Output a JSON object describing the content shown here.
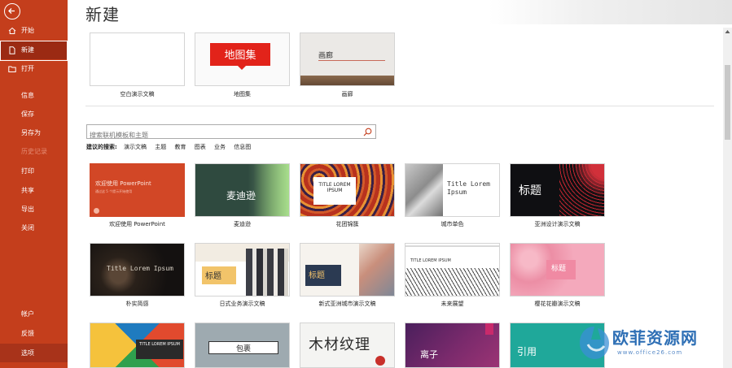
{
  "sidebar": {
    "items": [
      {
        "label": "开始",
        "icon": "home-icon"
      },
      {
        "label": "新建",
        "icon": "new-document-icon"
      },
      {
        "label": "打开",
        "icon": "folder-open-icon"
      },
      {
        "label": "信息"
      },
      {
        "label": "保存"
      },
      {
        "label": "另存为"
      },
      {
        "label": "历史记录"
      },
      {
        "label": "打印"
      },
      {
        "label": "共享"
      },
      {
        "label": "导出"
      },
      {
        "label": "关闭"
      },
      {
        "label": "帐户"
      },
      {
        "label": "反馈"
      },
      {
        "label": "选项"
      }
    ]
  },
  "page": {
    "title": "新建"
  },
  "featured": [
    {
      "caption": "空白演示文稿"
    },
    {
      "caption": "地图集",
      "thumb_text": "地图集"
    },
    {
      "caption": "画廊",
      "thumb_text": "画廊"
    }
  ],
  "search": {
    "placeholder": "搜索联机模板和主题",
    "suggest_label": "建议的搜索:",
    "suggestions": [
      "演示文稿",
      "主题",
      "教育",
      "图表",
      "业务",
      "信息图"
    ]
  },
  "templates": [
    {
      "caption": "欢迎使用 PowerPoint",
      "thumb_text": "欢迎使用 PowerPoint",
      "thumb_sub": "通过这 5 个提示开始使用"
    },
    {
      "caption": "麦迪逊",
      "thumb_text": "麦迪逊"
    },
    {
      "caption": "花团锦簇",
      "thumb_text": "TITLE LOREM IPSUM"
    },
    {
      "caption": "城市单色",
      "thumb_text": "Title Lorem Ipsum"
    },
    {
      "caption": "亚洲设计演示文稿",
      "thumb_text": "标题"
    },
    {
      "caption": "朴实简感",
      "thumb_text": "Title Lorem Ipsum"
    },
    {
      "caption": "日式业务演示文稿",
      "thumb_text": "标题"
    },
    {
      "caption": "新式亚洲城市演示文稿",
      "thumb_text": "标题"
    },
    {
      "caption": "未来展望",
      "thumb_text": "TITLE LOREM IPSUM"
    },
    {
      "caption": "樱花花瓣演示文稿",
      "thumb_text": "标题"
    },
    {
      "caption": "",
      "thumb_text": "TITLE LOREM IPSUM"
    },
    {
      "caption": "",
      "thumb_text": "包裹"
    },
    {
      "caption": "",
      "thumb_text": "木材纹理"
    },
    {
      "caption": "",
      "thumb_text": "离子"
    },
    {
      "caption": "",
      "thumb_text": "引用"
    }
  ],
  "watermark": {
    "text": "欧菲资源网",
    "url": "www.office26.com"
  },
  "colors": {
    "sidebar": "#c43e1c",
    "sidebar_active": "#9b2a13",
    "accent": "#d24726"
  }
}
